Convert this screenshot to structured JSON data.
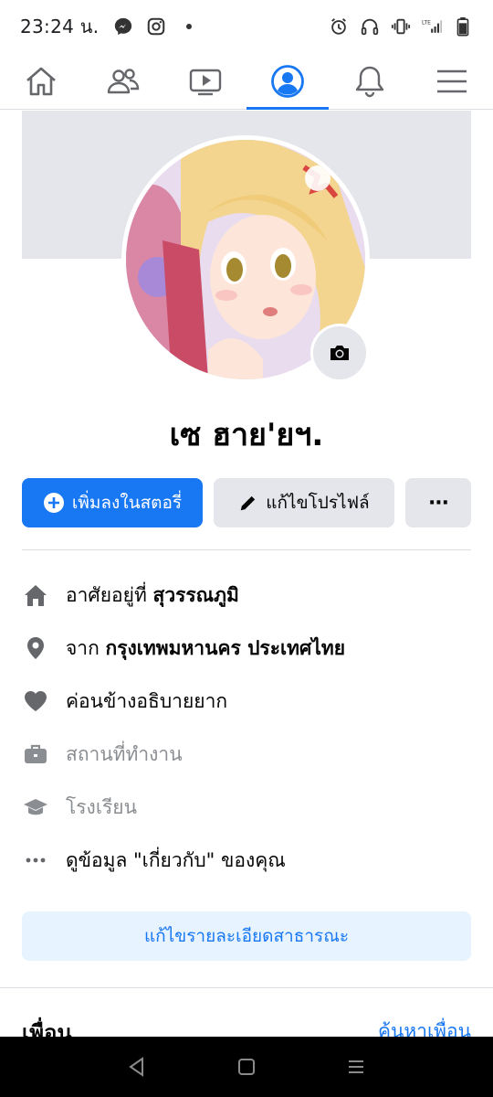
{
  "status_bar": {
    "time": "23:24 น.",
    "left_icons": [
      "messenger-icon",
      "instagram-icon",
      "notification-dot-icon"
    ],
    "right_icons": [
      "alarm-icon",
      "headphones-icon",
      "vibrate-icon",
      "lte-signal-icon",
      "battery-icon"
    ]
  },
  "nav": {
    "tabs": [
      {
        "name": "home",
        "icon": "home-icon",
        "active": false
      },
      {
        "name": "friends",
        "icon": "friends-icon",
        "active": false
      },
      {
        "name": "watch",
        "icon": "watch-icon",
        "active": false
      },
      {
        "name": "profile",
        "icon": "profile-icon",
        "active": true
      },
      {
        "name": "notifications",
        "icon": "bell-icon",
        "active": false
      },
      {
        "name": "menu",
        "icon": "menu-icon",
        "active": false
      }
    ]
  },
  "profile": {
    "name": "เซ ฮาย'ยฯ."
  },
  "buttons": {
    "add_story": "เพิ่มลงในสตอรี่",
    "edit_profile": "แก้ไขโปรไฟล์",
    "more": "···"
  },
  "info": {
    "lives_prefix": "อาศัยอยู่ที่",
    "lives_value": "สุวรรณภูมิ",
    "from_prefix": "จาก",
    "from_value": "กรุงเทพมหานคร ประเทศไทย",
    "relationship": "ค่อนข้างอธิบายยาก",
    "workplace": "สถานที่ทำงาน",
    "school": "โรงเรียน",
    "see_about": "ดูข้อมูล \"เกี่ยวกับ\" ของคุณ"
  },
  "edit_public_details": "แก้ไขรายละเอียดสาธารณะ",
  "friends": {
    "title": "เพื่อน",
    "find_link": "ค้นหาเพื่อน"
  },
  "colors": {
    "brand_blue": "#1877f2",
    "light_blue_bg": "#e7f3ff",
    "gray_button": "#e4e6eb",
    "icon_gray": "#65676b"
  }
}
